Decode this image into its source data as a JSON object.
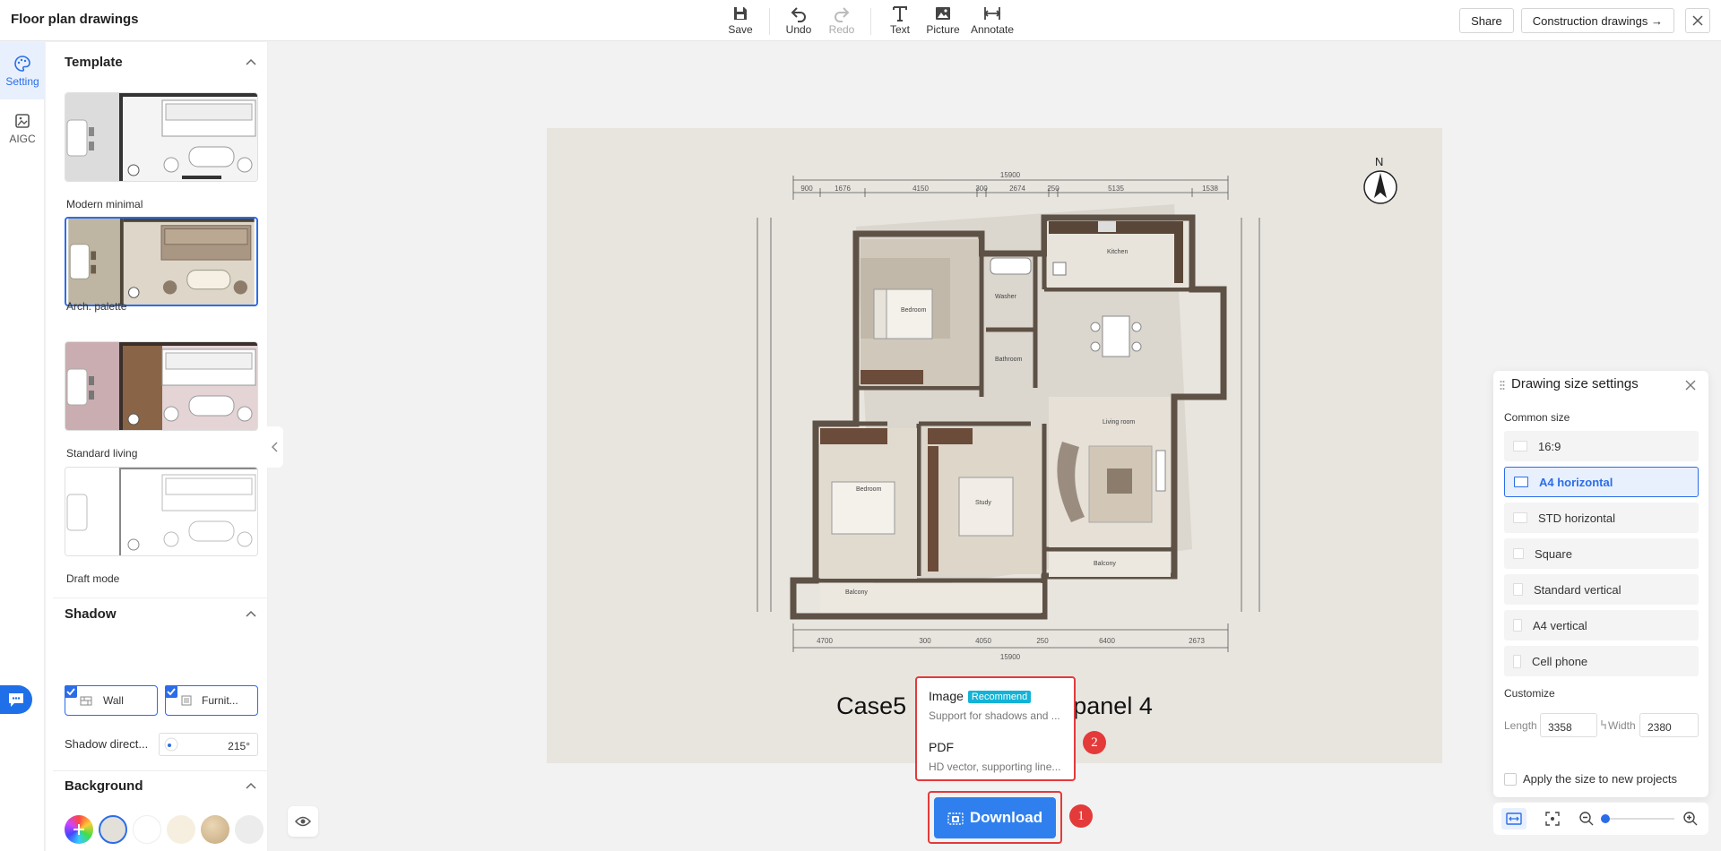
{
  "app": {
    "title": "Floor plan drawings"
  },
  "toolbar": {
    "save": "Save",
    "undo": "Undo",
    "redo": "Redo",
    "text": "Text",
    "picture": "Picture",
    "annotate": "Annotate"
  },
  "header": {
    "share": "Share",
    "construction": "Construction drawings →"
  },
  "rail": {
    "setting": "Setting",
    "aigc": "AIGC"
  },
  "template": {
    "title": "Template",
    "items": [
      {
        "label": "Modern minimal",
        "selected": false
      },
      {
        "label": "Arch. palette",
        "selected": true
      },
      {
        "label": "Standard living",
        "selected": false
      },
      {
        "label": "Draft mode",
        "selected": false
      }
    ]
  },
  "shadow": {
    "title": "Shadow",
    "wall": "Wall",
    "furniture": "Furnit...",
    "wall_checked": true,
    "furniture_checked": true,
    "direction_label": "Shadow direct...",
    "direction_value": "215°"
  },
  "background": {
    "title": "Background",
    "swatches": [
      "#e3e0da",
      "#ffffff",
      "#f6efdf",
      "#d5bf9a",
      "#ececec"
    ],
    "selected_index": 1
  },
  "canvas": {
    "title": "Case5 : Decorate wallpanel 4",
    "north": "N",
    "dimensions_top": [
      "15900",
      "900",
      "1676",
      "4150",
      "300",
      "2674",
      "250",
      "5135",
      "1538"
    ],
    "dimensions_bottom": [
      "4700",
      "300",
      "4050",
      "250",
      "6400",
      "2673",
      "15900"
    ],
    "rooms": [
      "Kitchen",
      "Bedroom",
      "Washer",
      "Bathroom",
      "Living room",
      "Bedroom",
      "Study",
      "Balcony",
      "Balcony"
    ]
  },
  "download": {
    "button": "Download",
    "options": [
      {
        "title": "Image",
        "badge": "Recommend",
        "desc": "Support for shadows and ..."
      },
      {
        "title": "PDF",
        "desc": "HD vector, supporting line..."
      }
    ],
    "callouts": [
      "1",
      "2"
    ]
  },
  "size_panel": {
    "title": "Drawing size settings",
    "common_label": "Common size",
    "options": [
      {
        "label": "16:9",
        "active": false
      },
      {
        "label": "A4 horizontal",
        "active": true
      },
      {
        "label": "STD horizontal",
        "active": false
      },
      {
        "label": "Square",
        "active": false
      },
      {
        "label": "Standard vertical",
        "active": false
      },
      {
        "label": "A4 vertical",
        "active": false
      },
      {
        "label": "Cell phone",
        "active": false
      }
    ],
    "customize_label": "Customize",
    "length_label": "Length",
    "length_value": "3358",
    "width_label": "Width",
    "width_value": "2380",
    "apply_label": "Apply the size to new projects"
  },
  "zoom": {
    "level_fraction": 0.0
  },
  "colors": {
    "accent": "#2b6de8",
    "highlight": "#e43a3a",
    "canvas_bg": "#e8e5df"
  }
}
